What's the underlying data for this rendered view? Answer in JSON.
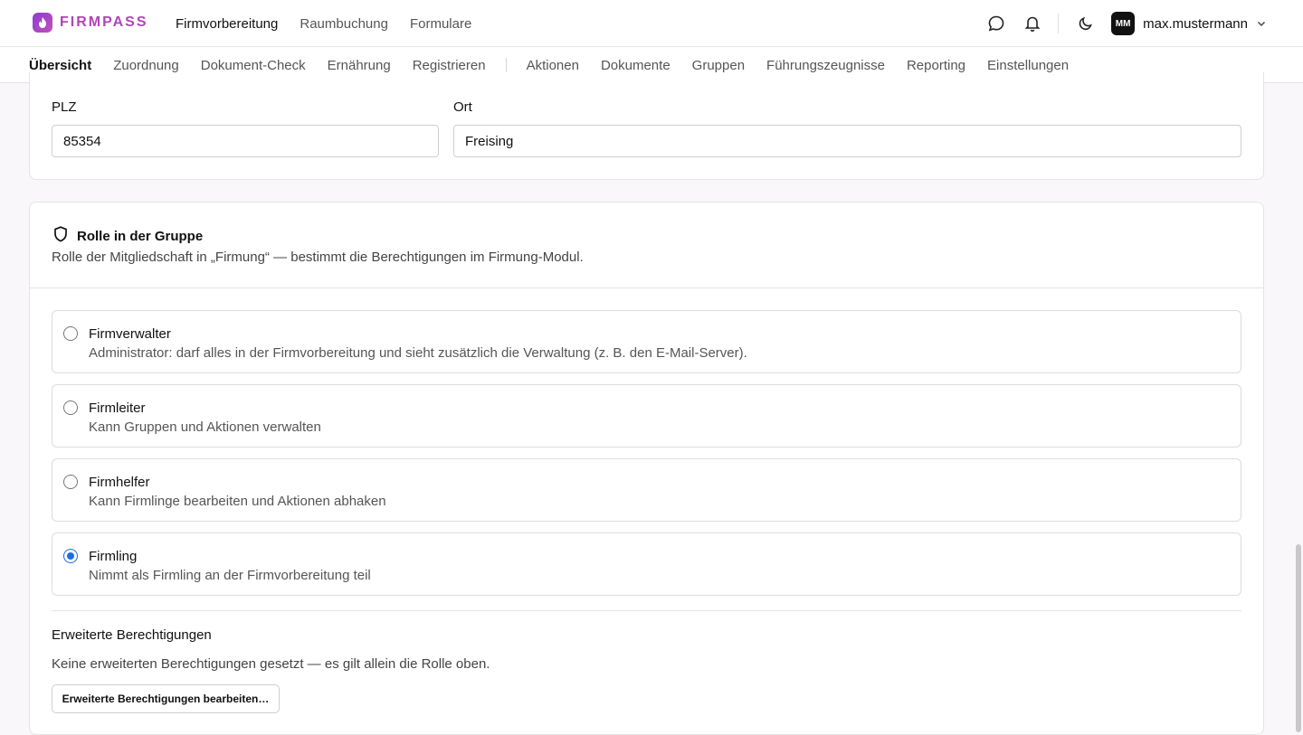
{
  "brand": {
    "name": "FIRMPASS"
  },
  "main_nav": [
    {
      "label": "Firmvorbereitung",
      "active": true
    },
    {
      "label": "Raumbuchung",
      "active": false
    },
    {
      "label": "Formulare",
      "active": false
    }
  ],
  "user": {
    "initials": "MM",
    "name": "max.mustermann"
  },
  "sub_nav": {
    "tabs_left": [
      {
        "label": "Übersicht",
        "active": true
      },
      {
        "label": "Zuordnung",
        "active": false
      },
      {
        "label": "Dokument-Check",
        "active": false
      },
      {
        "label": "Ernährung",
        "active": false
      },
      {
        "label": "Registrieren",
        "active": false
      }
    ],
    "tabs_right": [
      {
        "label": "Aktionen"
      },
      {
        "label": "Dokumente"
      },
      {
        "label": "Gruppen"
      },
      {
        "label": "Führungszeugnisse"
      },
      {
        "label": "Reporting"
      },
      {
        "label": "Einstellungen"
      }
    ]
  },
  "address": {
    "plz_label": "PLZ",
    "plz_value": "85354",
    "ort_label": "Ort",
    "ort_value": "Freising"
  },
  "role": {
    "title": "Rolle in der Gruppe",
    "description": "Rolle der Mitgliedschaft in „Firmung“ — bestimmt die Berechtigungen im Firmung-Modul.",
    "options": [
      {
        "title": "Firmverwalter",
        "desc": "Administrator: darf alles in der Firmvorbereitung und sieht zusätzlich die Verwaltung (z. B. den E-Mail-Server).",
        "checked": false
      },
      {
        "title": "Firmleiter",
        "desc": "Kann Gruppen und Aktionen verwalten",
        "checked": false
      },
      {
        "title": "Firmhelfer",
        "desc": "Kann Firmlinge bearbeiten und Aktionen abhaken",
        "checked": false
      },
      {
        "title": "Firmling",
        "desc": "Nimmt als Firmling an der Firmvorbereitung teil",
        "checked": true
      }
    ],
    "selected": "Firmling"
  },
  "extended": {
    "title": "Erweiterte Berechtigungen",
    "description": "Keine erweiterten Berechtigungen gesetzt — es gilt allein die Rolle oben.",
    "button_label": "Erweiterte Berechtigungen bearbeiten…"
  },
  "colors": {
    "brand": "#b045b8",
    "radio_selected": "#1a6fe0"
  }
}
